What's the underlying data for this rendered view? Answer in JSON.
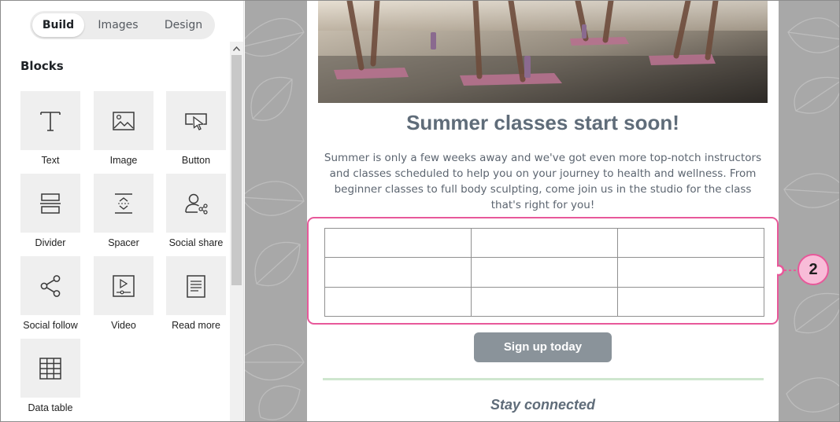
{
  "panel": {
    "tabs": [
      "Build",
      "Images",
      "Design"
    ],
    "active_tab": "Build",
    "heading": "Blocks",
    "blocks": [
      {
        "label": "Text",
        "icon": "text-icon"
      },
      {
        "label": "Image",
        "icon": "image-icon"
      },
      {
        "label": "Button",
        "icon": "button-icon"
      },
      {
        "label": "Divider",
        "icon": "divider-icon"
      },
      {
        "label": "Spacer",
        "icon": "spacer-icon"
      },
      {
        "label": "Social share",
        "icon": "social-share-icon"
      },
      {
        "label": "Social follow",
        "icon": "social-follow-icon"
      },
      {
        "label": "Video",
        "icon": "video-icon"
      },
      {
        "label": "Read more",
        "icon": "read-more-icon"
      },
      {
        "label": "Data table",
        "icon": "data-table-icon"
      }
    ]
  },
  "email": {
    "title": "Summer classes start soon!",
    "body": "Summer is only a few weeks away and we've got even more top-notch instructors and classes scheduled to help you on your journey to health and wellness. From beginner classes to full body sculpting, come join us in the studio for the class that's right for you!",
    "cta": "Sign up today",
    "section_heading": "Stay connected",
    "table": {
      "rows": 3,
      "columns": 3
    }
  },
  "callout": {
    "number": "2"
  },
  "colors": {
    "accent_pink": "#e8589a",
    "badge_fill": "#f8bcd8",
    "cta_gray": "#8a939a",
    "title_slate": "#5f6c79",
    "divider_green": "#cfe6cf"
  }
}
